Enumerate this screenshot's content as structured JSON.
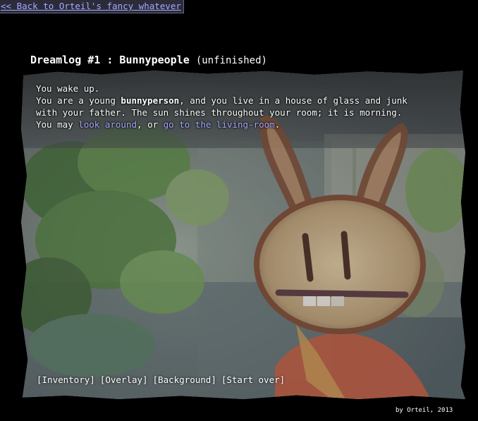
{
  "nav": {
    "back_link": "<< Back to Orteil's fancy whatever"
  },
  "header": {
    "title": "Dreamlog #1 : Bunnypeople",
    "status": "(unfinished)"
  },
  "story": {
    "line1": "You wake up.",
    "line2_pre": "You are a young ",
    "line2_bold": "bunnyperson",
    "line2_post": ", and you live in a house of glass and junk",
    "line3": "with your father. The sun shines throughout your room; it is morning.",
    "line4_pre": "You may ",
    "link_look": "look around",
    "line4_mid": ", or ",
    "link_living": "go to the living-room",
    "line4_post": "."
  },
  "menu": {
    "inventory": "[Inventory]",
    "overlay": "[Overlay]",
    "background": "[Background]",
    "start_over": "[Start over]"
  },
  "footer": {
    "credit": "by Orteil, 2013"
  },
  "colors": {
    "background": "#000000",
    "link": "#a9a9ff",
    "text": "#ffffff"
  }
}
